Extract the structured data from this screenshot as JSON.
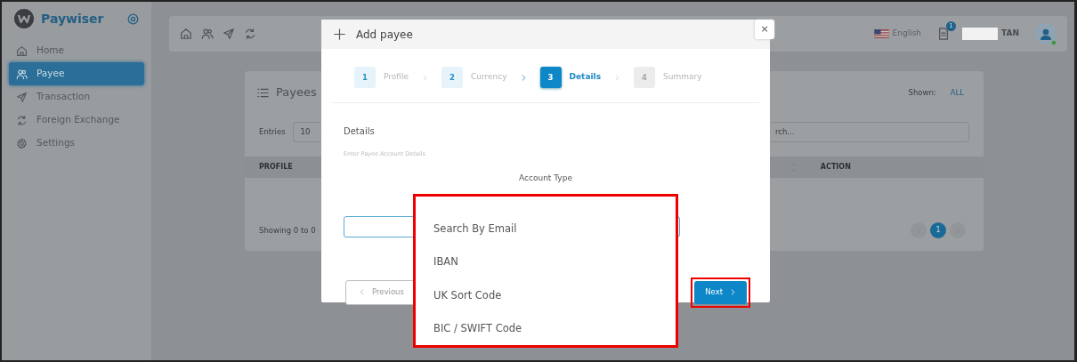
{
  "sidebar": {
    "brand": "Paywiser",
    "items": [
      {
        "label": "Home",
        "selected": false
      },
      {
        "label": "Payee",
        "selected": true
      },
      {
        "label": "Transaction",
        "selected": false
      },
      {
        "label": "Foreign Exchange",
        "selected": false
      },
      {
        "label": "Settings",
        "selected": false
      }
    ]
  },
  "topbar": {
    "language": "English",
    "notification_count": "1",
    "user_name": "TAN"
  },
  "payees_card": {
    "title": "Payees",
    "shown_label": "Shown:",
    "shown_value": "ALL",
    "entries_label": "Entries",
    "entries_value": "10",
    "search_placeholder": "rch...",
    "columns": [
      "PROFILE",
      "ACTION"
    ],
    "footer": "Showing 0 to 0",
    "pages": [
      {
        "label": "1",
        "selected": true
      }
    ]
  },
  "modal": {
    "title": "Add payee",
    "close_symbol": "×",
    "steps": [
      {
        "number": "1",
        "label": "Profile",
        "completed": true,
        "selected": false
      },
      {
        "number": "2",
        "label": "Currency",
        "completed": true,
        "selected": false
      },
      {
        "number": "3",
        "label": "Details",
        "completed": false,
        "selected": true
      },
      {
        "number": "4",
        "label": "Summary",
        "completed": false,
        "selected": false
      }
    ],
    "section_title": "Details",
    "section_hint": "Enter Payee Account Details",
    "field_label": "Account Type",
    "dropdown": {
      "open": true,
      "highlighted": true,
      "options": [
        "Search By Email",
        "IBAN",
        "UK Sort Code",
        "BIC / SWIFT Code"
      ]
    },
    "buttons": [
      {
        "label": "Previous",
        "kind": "previous",
        "highlighted": false
      },
      {
        "label": "Next",
        "kind": "next",
        "highlighted": true
      }
    ]
  }
}
